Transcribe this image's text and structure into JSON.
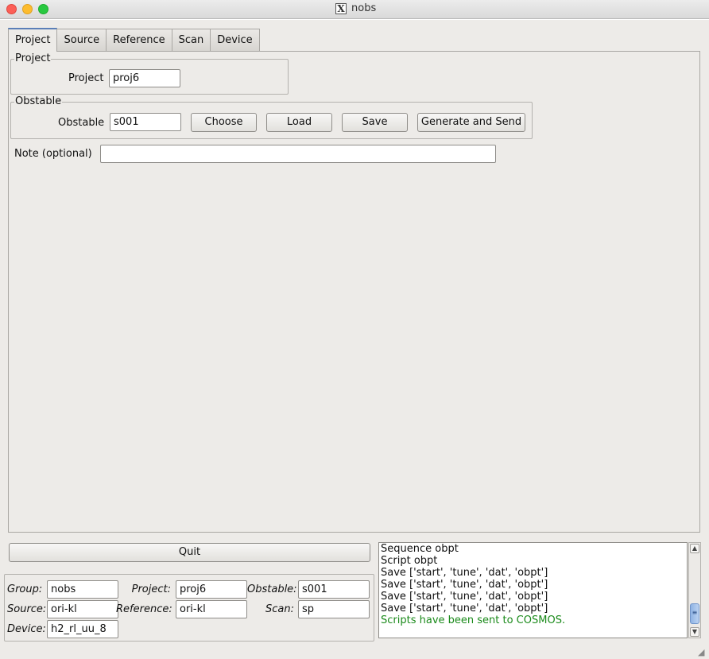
{
  "window": {
    "title": "nobs"
  },
  "tabs": [
    {
      "label": "Project"
    },
    {
      "label": "Source"
    },
    {
      "label": "Reference"
    },
    {
      "label": "Scan"
    },
    {
      "label": "Device"
    }
  ],
  "project_group": {
    "legend": "Project",
    "label": "Project",
    "value": "proj6"
  },
  "obstable_group": {
    "legend": "Obstable",
    "label": "Obstable",
    "value": "s001",
    "buttons": {
      "choose": "Choose",
      "load": "Load",
      "save": "Save",
      "generate": "Generate and Send"
    }
  },
  "note": {
    "label": "Note (optional)",
    "value": ""
  },
  "quit_label": "Quit",
  "status": {
    "group": {
      "label": "Group:",
      "value": "nobs"
    },
    "project": {
      "label": "Project:",
      "value": "proj6"
    },
    "obstable": {
      "label": "Obstable:",
      "value": "s001"
    },
    "source": {
      "label": "Source:",
      "value": "ori-kl"
    },
    "reference": {
      "label": "Reference:",
      "value": "ori-kl"
    },
    "scan": {
      "label": "Scan:",
      "value": "sp"
    },
    "device": {
      "label": "Device:",
      "value": "h2_rl_uu_8"
    }
  },
  "log": {
    "lines": [
      "Sequence obpt",
      "Script obpt",
      "Save ['start', 'tune', 'dat', 'obpt']",
      "Save ['start', 'tune', 'dat', 'obpt']",
      "Save ['start', 'tune', 'dat', 'obpt']",
      "Save ['start', 'tune', 'dat', 'obpt']"
    ],
    "success_line": "Scripts have been sent to COSMOS.",
    "success_color": "#1a8a1a"
  },
  "colors": {
    "accent": "#5b7fb8",
    "window_bg": "#edebe8"
  }
}
